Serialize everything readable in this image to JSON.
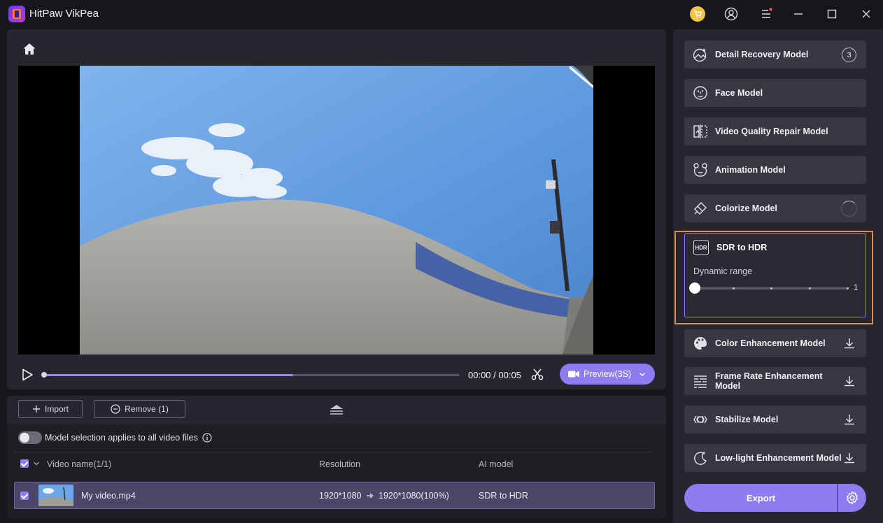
{
  "app": {
    "title": "HitPaw VikPea"
  },
  "player": {
    "time": "00:00 / 00:05",
    "progress": 0.6,
    "preview_label": "Preview(3S)"
  },
  "list": {
    "import_label": "Import",
    "remove_label": "Remove (1)",
    "toggle_label": "Model selection applies to all video files",
    "headers": {
      "name": "Video name(1/1)",
      "resolution": "Resolution",
      "model": "AI model"
    },
    "row": {
      "name": "My video.mp4",
      "res_from": "1920*1080",
      "res_to": "1920*1080(100%)",
      "model": "SDR to HDR"
    }
  },
  "models": {
    "detail_recovery": {
      "label": "Detail Recovery Model",
      "badge": "3"
    },
    "face": {
      "label": "Face Model"
    },
    "video_quality_repair": {
      "label": "Video Quality Repair Model"
    },
    "animation": {
      "label": "Animation Model"
    },
    "colorize": {
      "label": "Colorize Model"
    },
    "sdr_to_hdr": {
      "label": "SDR to HDR",
      "icon_text": "HDR",
      "slider_label": "Dynamic range",
      "slider_value": "1",
      "slider_level": 0
    },
    "color_enhancement": {
      "label": "Color Enhancement Model"
    },
    "frame_rate": {
      "label_line1": "Frame Rate Enhancement",
      "label_line2": "Model"
    },
    "stabilize": {
      "label": "Stabilize Model"
    },
    "low_light": {
      "label": "Low-light Enhancement Model"
    }
  },
  "export": {
    "label": "Export"
  },
  "colors": {
    "accent": "#8f7cf0",
    "highlight": "#f08a2c",
    "panel": "#26262f",
    "card": "#383843"
  }
}
